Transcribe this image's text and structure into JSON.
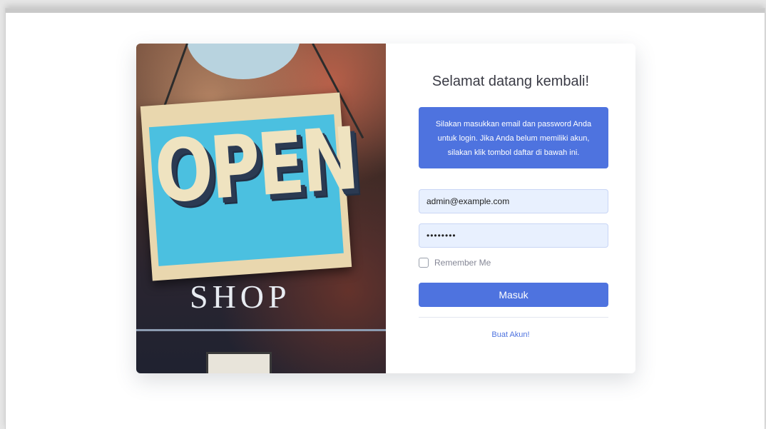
{
  "login": {
    "title": "Selamat datang kembali!",
    "info_message": "Silakan masukkan email dan password Anda untuk login. Jika Anda belum memiliki akun, silakan klik tombol daftar di bawah ini.",
    "email_value": "admin@example.com",
    "password_value": "••••••••",
    "remember_label": "Remember Me",
    "submit_label": "Masuk",
    "register_link": "Buat Akun!"
  },
  "hero": {
    "sign_text": "OPEN",
    "shop_text": "SHOP"
  },
  "colors": {
    "primary": "#4e73df",
    "input_bg": "#e8f0fe",
    "title": "#3a3b45",
    "muted": "#858796"
  }
}
